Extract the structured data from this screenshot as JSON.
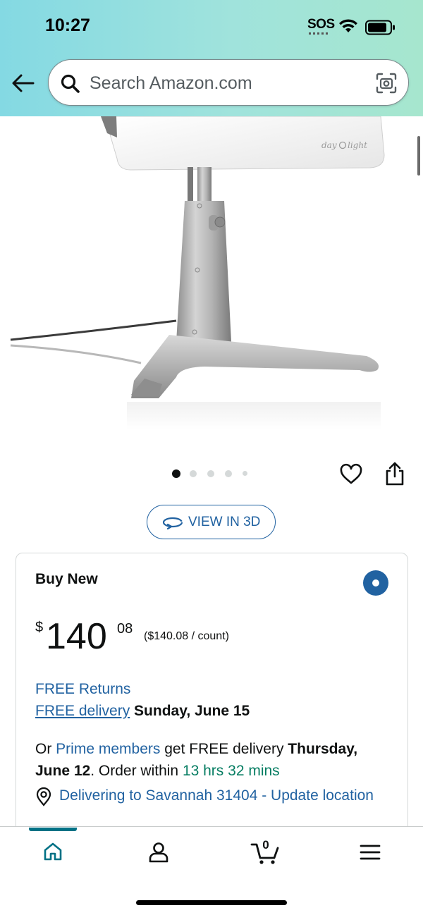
{
  "status_bar": {
    "time": "10:27",
    "sos": "SOS"
  },
  "search": {
    "placeholder": "Search Amazon.com"
  },
  "product": {
    "brand_mark": "day light"
  },
  "gallery": {
    "image_count": 5,
    "current_index": 1
  },
  "view_3d": {
    "label": "VIEW IN 3D"
  },
  "offer": {
    "title": "Buy New",
    "price": {
      "symbol": "$",
      "whole": "140",
      "fraction": "08",
      "unit_price": "($140.08 / count)"
    },
    "free_returns": "FREE Returns",
    "free_delivery_link": "FREE delivery",
    "free_delivery_date": "Sunday, June 15",
    "prime": {
      "prefix": "Or",
      "link": "Prime members",
      "middle": "get FREE delivery",
      "date": "Thursday, June 12",
      "order_within": ". Order within",
      "countdown": "13 hrs 32 mins"
    },
    "delivery_location": "Delivering to Savannah 31404 - Update location"
  },
  "tabbar": {
    "cart_count": "0"
  },
  "colors": {
    "link": "#2162a1",
    "teal": "#007185",
    "green": "#067d62"
  }
}
